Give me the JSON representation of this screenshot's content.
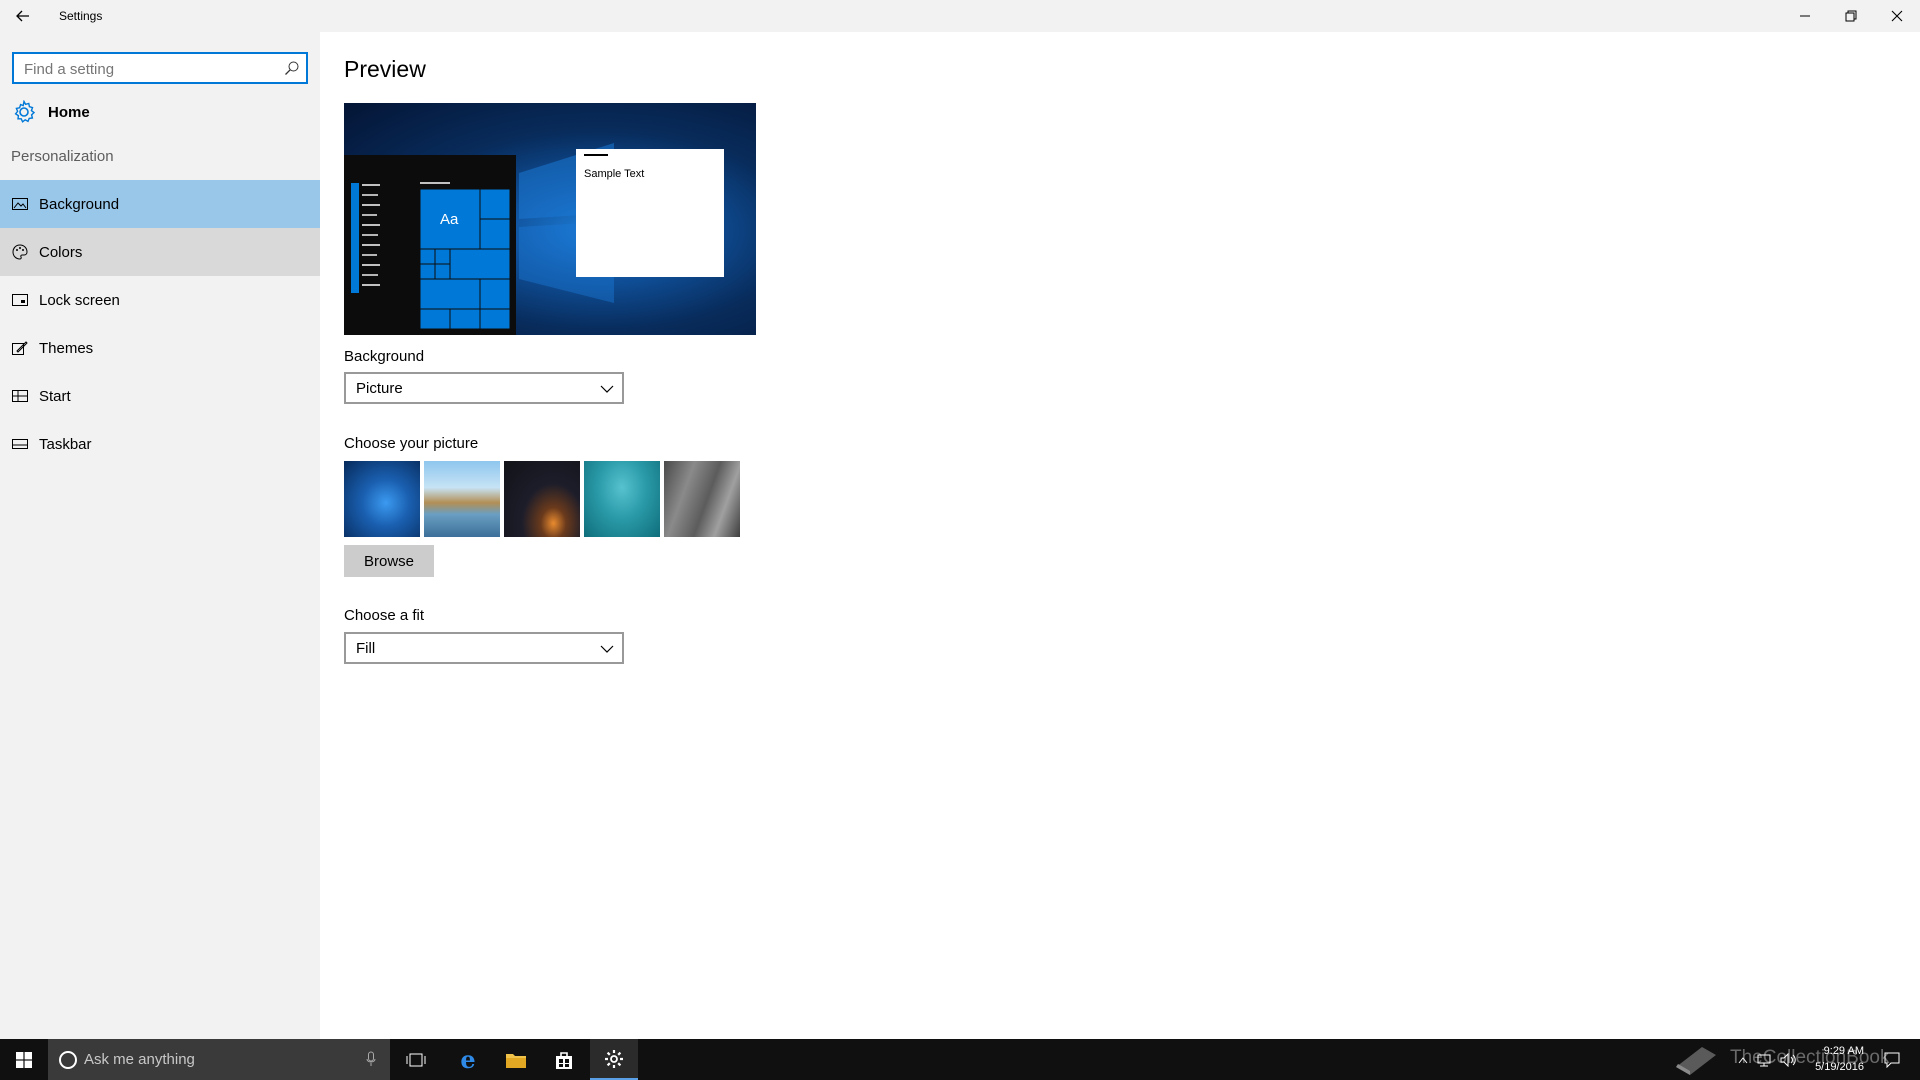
{
  "window": {
    "title": "Settings"
  },
  "sidebar": {
    "search_placeholder": "Find a setting",
    "home_label": "Home",
    "section_title": "Personalization",
    "items": [
      {
        "label": "Background",
        "icon": "picture-icon",
        "state": "selected"
      },
      {
        "label": "Colors",
        "icon": "palette-icon",
        "state": "hover"
      },
      {
        "label": "Lock screen",
        "icon": "lock-screen-icon",
        "state": "normal"
      },
      {
        "label": "Themes",
        "icon": "brush-icon",
        "state": "normal"
      },
      {
        "label": "Start",
        "icon": "start-tiles-icon",
        "state": "normal"
      },
      {
        "label": "Taskbar",
        "icon": "taskbar-icon",
        "state": "normal"
      }
    ]
  },
  "main": {
    "heading": "Preview",
    "preview": {
      "tile_label": "Aa",
      "sample_text": "Sample Text"
    },
    "background": {
      "label": "Background",
      "value": "Picture"
    },
    "choose_picture": {
      "label": "Choose your picture",
      "thumbnails": [
        "windows-hero-wallpaper",
        "beach-rock-arch",
        "night-sky-tent",
        "underwater-swimmer",
        "rock-cliff"
      ]
    },
    "browse_label": "Browse",
    "fit": {
      "label": "Choose a fit",
      "value": "Fill"
    }
  },
  "taskbar": {
    "search_placeholder": "Ask me anything",
    "pinned": [
      "task-view-icon",
      "edge-icon",
      "file-explorer-icon",
      "store-icon",
      "settings-icon"
    ],
    "time": "9:29 AM",
    "date": "5/19/2016",
    "watermark": "TheCollectionBook"
  },
  "colors": {
    "accent": "#0078d7",
    "selected_nav": "#99c7ea",
    "hover_nav": "#d9d9d9",
    "sidebar_bg": "#f2f2f2",
    "taskbar_bg": "#101010"
  }
}
